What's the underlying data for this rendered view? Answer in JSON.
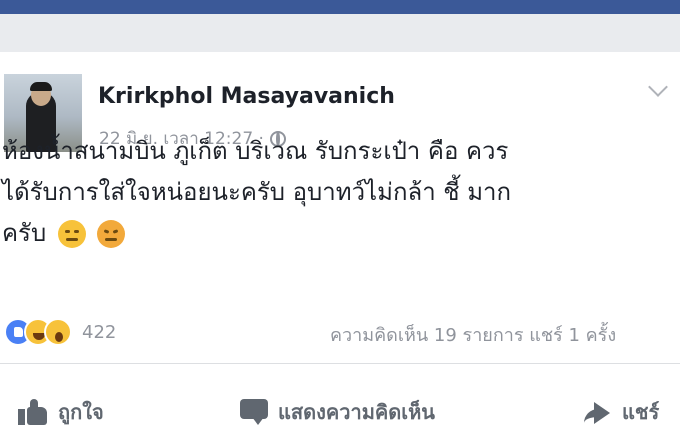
{
  "post": {
    "author": "Krirkphol Masayavanich",
    "timestamp": "22 มิ.ย. เวลา 12:27 ·",
    "privacy_icon": "globe-icon",
    "text_lines": [
      "ห้องน้ำสนามบิน ภูเก็ต บริเวณ รับกระเป๋า คือ ควร",
      "ได้รับการใส่ใจหน่อยนะครับ อุบาทว์ไม่กล้า ชี้ มาก",
      "ครับ"
    ],
    "emojis": [
      "confused-face-icon",
      "angry-face-icon"
    ]
  },
  "reactions": {
    "icons": [
      "like-reaction-icon",
      "haha-reaction-icon",
      "wow-reaction-icon"
    ],
    "count": "422"
  },
  "stats": {
    "text": "ความคิดเห็น 19 รายการ แชร์ 1 ครั้ง"
  },
  "actions": {
    "like": "ถูกใจ",
    "comment": "แสดงความคิดเห็น",
    "share": "แชร์"
  },
  "colors": {
    "brand": "#3b5998",
    "background": "#e9ebee",
    "meta_text": "#90949c",
    "action_text": "#606770"
  }
}
